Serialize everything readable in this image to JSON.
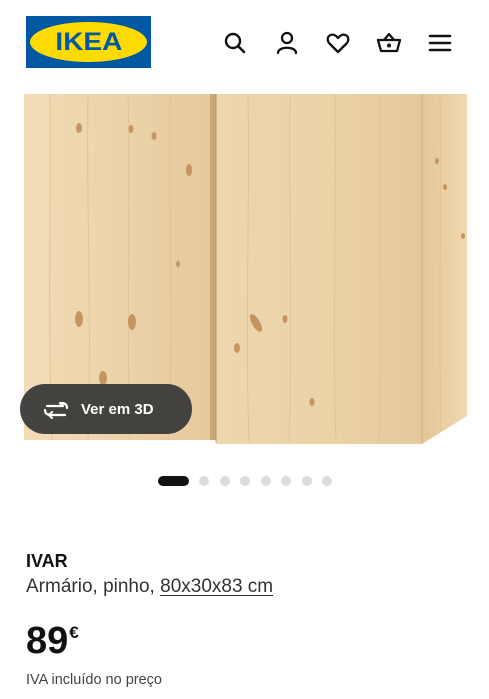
{
  "header": {
    "logo_text": "IKEA",
    "icons": [
      "search-icon",
      "user-icon",
      "heart-icon",
      "basket-icon",
      "menu-icon"
    ]
  },
  "gallery": {
    "view_3d_label": "Ver em 3D",
    "view_3d_icon": "rotate-3d-icon",
    "slide_count": 8,
    "active_slide": 1
  },
  "product": {
    "name": "IVAR",
    "description": "Armário, pinho, ",
    "dimensions": "80x30x83 cm",
    "price_integer": "89",
    "price_currency": "€",
    "vat_note": "IVA incluído no preço"
  },
  "colors": {
    "brand_blue": "#0058a3",
    "brand_yellow": "#ffdb00",
    "pine_wood": "#ecd2a8"
  }
}
